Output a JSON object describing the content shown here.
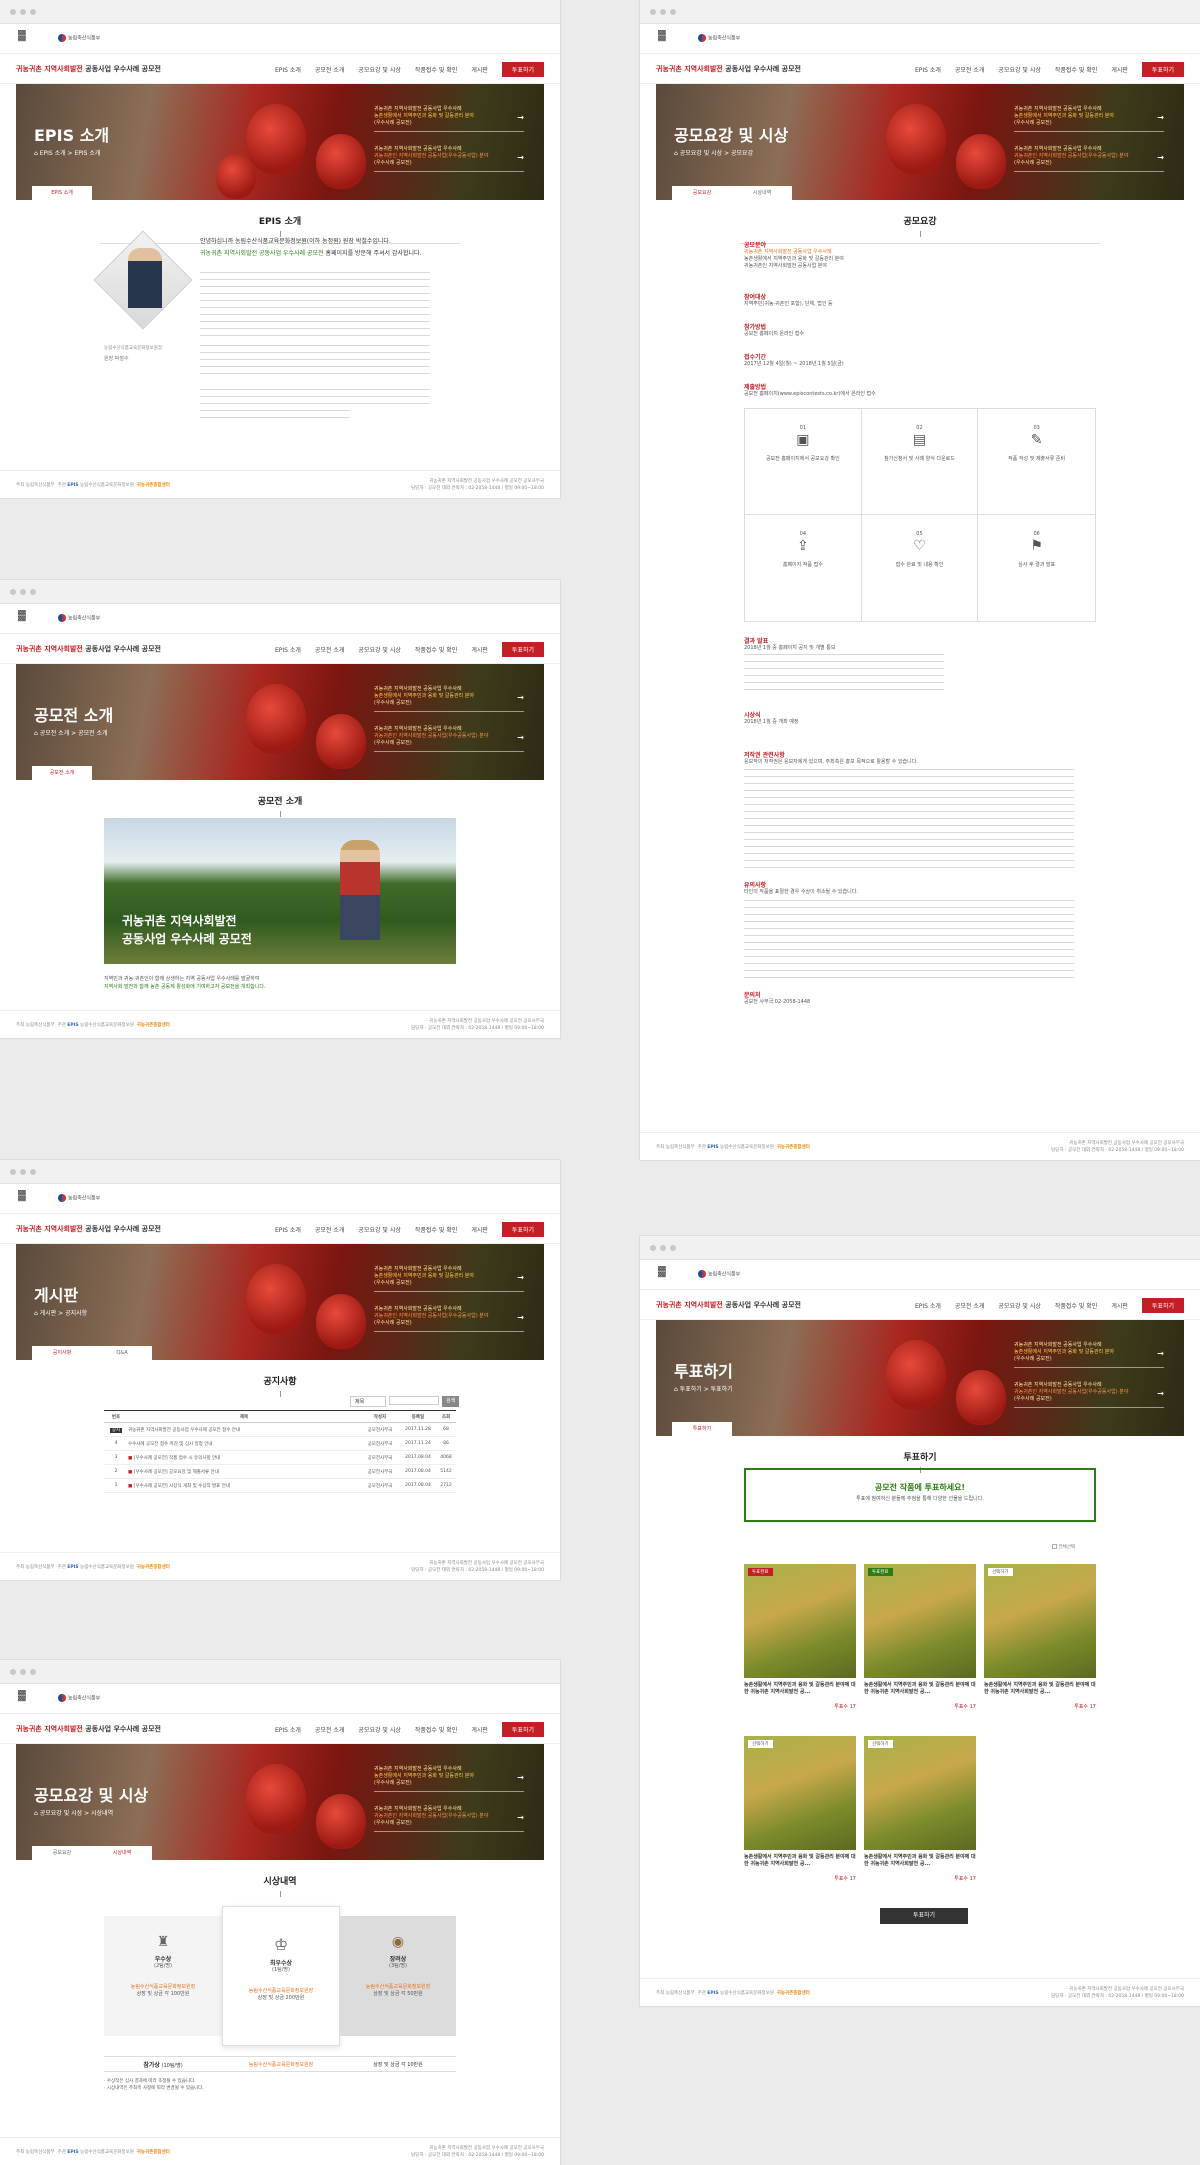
{
  "site": {
    "title_red": "귀농귀촌 지역사회발전",
    "title_rest": "공동사업 우수사례 공모전",
    "menu": [
      "EPIS 소개",
      "공모전 소개",
      "공모요강 및 시상",
      "작품접수 및 확인",
      "게시판"
    ],
    "vote_button": "투표하기",
    "hero_side_1a": "귀농귀촌 지역사회발전 공동사업 우수사례",
    "hero_side_1b": "농촌생활에서 지역주민과 융화 및 갈등관리 분야",
    "hero_side_1c": "(우수사례 공모전)",
    "hero_side_2a": "귀농귀촌 지역사회발전 공동사업 우수사례",
    "hero_side_2b": "귀농귀촌인 지역사회발전 공동사업(우수공동사업) 분야",
    "hero_side_2c": "(우수사례 공모전)",
    "footer_host": "주최",
    "footer_host_org": "농림축산식품부",
    "footer_org": "주관",
    "footer_org_name": "EPIS",
    "footer_org_full": "농림수산식품교육문화정보원",
    "footer_center": "귀농귀촌종합센터",
    "footer_r1": "귀농귀촌 지역사회발전 공동사업 우수사례 공모전 공모사무국",
    "footer_r2": "담당자 : 공모전 대외 연락처 : 02-2058-1448 / 평일 09:00~18:00"
  },
  "pages": {
    "epis": {
      "heading": "EPIS 소개",
      "crumb": "EPIS 소개 > EPIS 소개",
      "tab": "EPIS 소개",
      "section": "EPIS 소개",
      "greeting_1": "안녕하십니까 농림수산식품교육문화정보원(이하 농정원) 원장 박철수입니다.",
      "greeting_2": "귀농귀촌 지역사회발전 공동사업 우수사례 공모전",
      "greeting_3": "홈페이지를 방문해 주셔서 감사합니다.",
      "caption": "농림수산식품교육문화정보원장",
      "signature": "원장 박철수"
    },
    "contest": {
      "heading": "공모전 소개",
      "crumb": "공모전 소개 > 공모전 소개",
      "tab": "공모전 소개",
      "section": "공모전 소개",
      "image_line1": "귀농귀촌 지역사회발전",
      "image_line2": "공동사업 우수사례 공모전",
      "desc_1": "지역민과 귀농․귀촌인이 함께 상생하는 지역 공동사업 우수사례를 발굴하여",
      "desc_2": "지역사회 발전과 함께 농촌 공동체 활성화에 기여하고자 공모전을 개최합니다."
    },
    "board": {
      "heading": "게시판",
      "crumb": "게시판 > 공지사항",
      "tab_on": "공지사항",
      "tab_off": "Q&A",
      "section": "공지사항",
      "search_select": "제목",
      "search_button": "검색",
      "columns": [
        "번호",
        "제목",
        "작성자",
        "등록일",
        "조회"
      ],
      "rows": [
        {
          "no": "공지",
          "title": "귀농귀촌 지역사회발전 공동사업 우수사례 공모전 접수 안내",
          "author": "공모전사무국",
          "date": "2017.11.28",
          "views": "68"
        },
        {
          "no": "4",
          "title": "우수사례 공모전 접수 마감 및 심사 일정 안내",
          "author": "공모전사무국",
          "date": "2017.11.24",
          "views": "86"
        },
        {
          "no": "3",
          "title": "[우수사례 공모전] 작품 접수 시 유의사항 안내",
          "author": "공모전사무국",
          "date": "2017.08.04",
          "views": "4068"
        },
        {
          "no": "2",
          "title": "[우수사례 공모전] 공모요강 및 제출서류 안내",
          "author": "공모전사무국",
          "date": "2017.08.04",
          "views": "5142"
        },
        {
          "no": "1",
          "title": "[우수사례 공모전] 시상식 개최 및 수상작 발표 안내",
          "author": "공모전사무국",
          "date": "2017.08.04",
          "views": "2712"
        }
      ]
    },
    "awards": {
      "heading": "공모요강 및 시상",
      "crumb": "공모요강 및 시상 > 시상내역",
      "tab_off": "공모요강",
      "tab_on": "시상내역",
      "section": "시상내역",
      "cards": [
        {
          "title": "우수상",
          "count": "(2팀/명)",
          "org": "농림수산식품교육문화정보원장",
          "prize": "상장 및 상금 각 100만원"
        },
        {
          "title": "최우수상",
          "count": "(1팀/명)",
          "org": "농림수산식품교육문화정보원장",
          "prize": "상장 및 상금 200만원"
        },
        {
          "title": "장려상",
          "count": "(3팀/명)",
          "org": "농림수산식품교육문화정보원장",
          "prize": "상장 및 상금 각 50만원"
        }
      ],
      "extra_title": "참가상",
      "extra_count": "(10팀/명)",
      "extra_org": "농림수산식품교육문화정보원장",
      "extra_prize": "상장 및 상금 각 10만원",
      "note_1": "수상작은 심사 결과에 따라 조정될 수 있습니다.",
      "note_2": "시상내역은 주최측 사정에 따라 변경될 수 있습니다."
    },
    "guide": {
      "heading": "공모요강 및 시상",
      "crumb": "공모요강 및 시상 > 공모요강",
      "tab_on": "공모요강",
      "tab_off": "시상내역",
      "section": "공모요강",
      "blocks": [
        {
          "title": "공모분야",
          "lines": [
            "귀농귀촌 지역사회발전 공동사업 우수사례",
            "농촌생활에서 지역주민과 융화 및 갈등관리 분야",
            "귀농귀촌인 지역사회발전 공동사업 분야"
          ]
        },
        {
          "title": "참여대상",
          "lines": [
            "지역주민(귀농·귀촌인 포함), 단체, 법인 등"
          ]
        },
        {
          "title": "참가방법",
          "lines": [
            "공모전 홈페이지 온라인 접수"
          ]
        },
        {
          "title": "접수기간",
          "lines": [
            "2017년 12월 4일(월) ~ 2018년 1월 5일(금)"
          ]
        },
        {
          "title": "제출방법",
          "lines": [
            "공모전 홈페이지(www.episcontests.co.kr)에서 온라인 접수"
          ]
        }
      ],
      "steps": [
        {
          "no": "01",
          "text": "공모전 홈페이지에서 공모요강 확인"
        },
        {
          "no": "02",
          "text": "참가신청서 및 사례 양식 다운로드"
        },
        {
          "no": "03",
          "text": "작품 작성 및 제출서류 준비"
        },
        {
          "no": "04",
          "text": "홈페이지 작품 접수"
        },
        {
          "no": "05",
          "text": "접수 완료 및 내용 확인"
        },
        {
          "no": "06",
          "text": "심사 후 결과 발표"
        }
      ],
      "blocks2": [
        {
          "title": "결과 발표",
          "lines": [
            "2018년 1월 중 홈페이지 공지 및 개별 통보"
          ]
        },
        {
          "title": "시상식",
          "lines": [
            "2018년 1월 중 개최 예정"
          ]
        },
        {
          "title": "저작권 관련사항",
          "lines": [
            "응모작의 저작권은 응모자에게 있으며, 주최측은 홍보 목적으로 활용할 수 있습니다."
          ]
        },
        {
          "title": "유의사항",
          "lines": [
            "타인의 작품을 표절한 경우 수상이 취소될 수 있습니다."
          ]
        },
        {
          "title": "문의처",
          "lines": [
            "공모전 사무국 02-2058-1448"
          ]
        }
      ]
    },
    "vote": {
      "heading": "투표하기",
      "crumb": "투표하기 > 투표하기",
      "tab": "투표하기",
      "section": "투표하기",
      "banner_title": "공모전 작품에 투표하세요!",
      "banner_sub": "투표에 참여하신 분들께 추첨을 통해 다양한 선물을 드립니다.",
      "filter_label": "전체선택",
      "cards": [
        {
          "badge": "투표완료",
          "title": "농촌생활에서 지역주민과 융화 및 갈등관리 분야에 대한 귀농귀촌 지역사회발전 공...",
          "count": "투표수 17"
        },
        {
          "badge": "투표완료",
          "title": "농촌생활에서 지역주민과 융화 및 갈등관리 분야에 대한 귀농귀촌 지역사회발전 공...",
          "count": "투표수 17"
        },
        {
          "badge": "선택하기",
          "title": "농촌생활에서 지역주민과 융화 및 갈등관리 분야에 대한 귀농귀촌 지역사회발전 공...",
          "count": "투표수 17"
        },
        {
          "badge": "선택하기",
          "title": "농촌생활에서 지역주민과 융화 및 갈등관리 분야에 대한 귀농귀촌 지역사회발전 공...",
          "count": "투표수 17"
        },
        {
          "badge": "선택하기",
          "title": "농촌생활에서 지역주민과 융화 및 갈등관리 분야에 대한 귀농귀촌 지역사회발전 공...",
          "count": "투표수 17"
        }
      ],
      "submit": "투표하기"
    }
  },
  "colors": {
    "accent": "#c41f25",
    "green": "#2d7d14",
    "orange": "#e9731c"
  }
}
